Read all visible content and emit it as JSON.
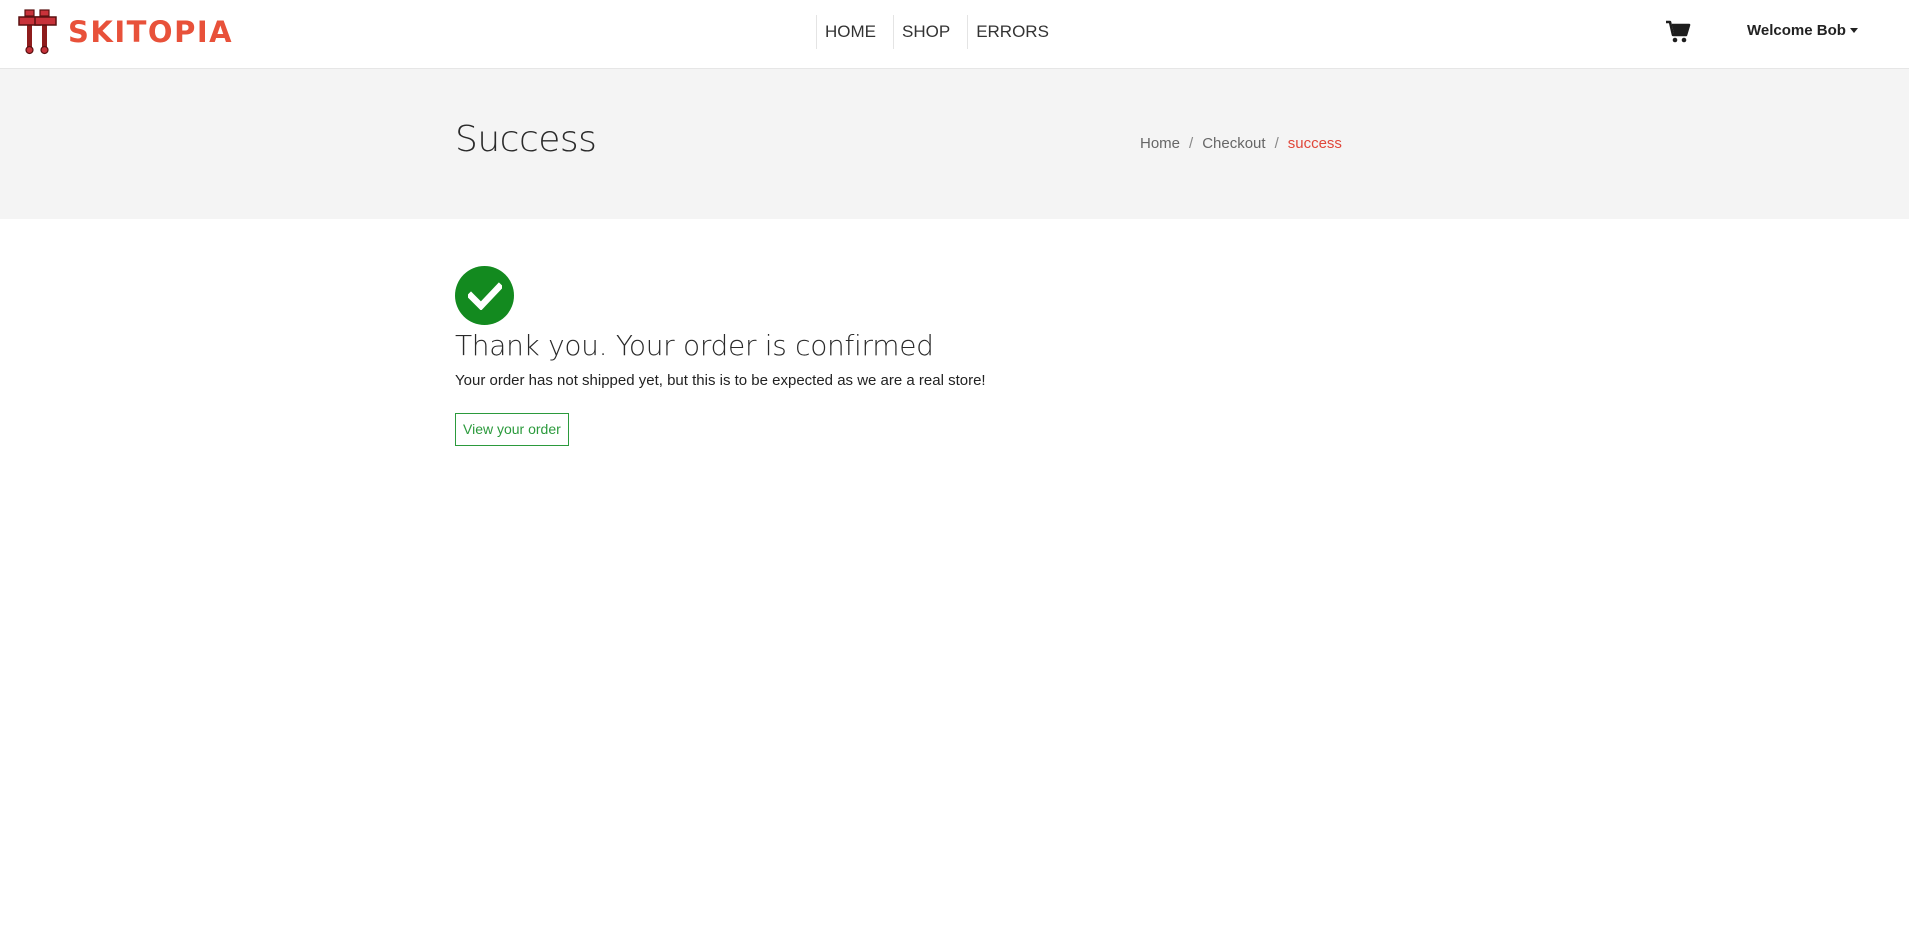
{
  "brand": {
    "name": "SKITOPIA",
    "icon": "ski-poles-logo",
    "color": "#e8513a"
  },
  "nav": {
    "links": [
      {
        "label": "HOME"
      },
      {
        "label": "SHOP"
      },
      {
        "label": "ERRORS"
      }
    ],
    "cart_icon": "shopping-cart-icon",
    "welcome_label": "Welcome Bob"
  },
  "hero": {
    "title": "Success",
    "breadcrumb": [
      {
        "label": "Home"
      },
      {
        "label": "Checkout"
      },
      {
        "label": "success"
      }
    ],
    "separator": "/"
  },
  "confirmation": {
    "icon": "check-circle-icon",
    "icon_color": "#138a1f",
    "title": "Thank you. Your order is confirmed",
    "message": "Your order has not shipped yet, but this is to be expected as we are a real store!",
    "button_label": "View your order",
    "button_color": "#2b9a3c"
  }
}
